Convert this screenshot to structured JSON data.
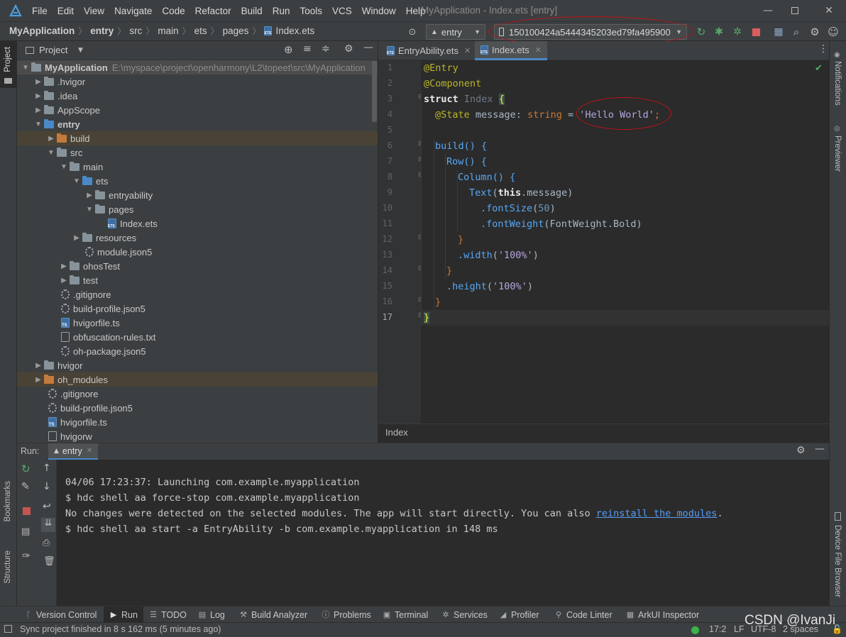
{
  "window": {
    "title": "MyApplication - Index.ets [entry]"
  },
  "menu": [
    "File",
    "Edit",
    "View",
    "Navigate",
    "Code",
    "Refactor",
    "Build",
    "Run",
    "Tools",
    "VCS",
    "Window",
    "Help"
  ],
  "breadcrumb": [
    "MyApplication",
    "entry",
    "src",
    "main",
    "ets",
    "pages",
    "Index.ets"
  ],
  "toolbar": {
    "module_combo": "entry",
    "device_combo": "150100424a5444345203ed79fa495900"
  },
  "project_panel": {
    "title": "Project",
    "root": "MyApplication",
    "root_path": "E:\\myspace\\project\\openharmony\\L2\\topeet\\src\\MyApplication",
    "items": [
      {
        "label": ".hvigor"
      },
      {
        "label": ".idea"
      },
      {
        "label": "AppScope"
      },
      {
        "label": "entry"
      },
      {
        "label": "build"
      },
      {
        "label": "src"
      },
      {
        "label": "main"
      },
      {
        "label": "ets"
      },
      {
        "label": "entryability"
      },
      {
        "label": "pages"
      },
      {
        "label": "Index.ets"
      },
      {
        "label": "resources"
      },
      {
        "label": "module.json5"
      },
      {
        "label": "ohosTest"
      },
      {
        "label": "test"
      },
      {
        "label": ".gitignore"
      },
      {
        "label": "build-profile.json5"
      },
      {
        "label": "hvigorfile.ts"
      },
      {
        "label": "obfuscation-rules.txt"
      },
      {
        "label": "oh-package.json5"
      },
      {
        "label": "hvigor"
      },
      {
        "label": "oh_modules"
      },
      {
        "label": ".gitignore"
      },
      {
        "label": "build-profile.json5"
      },
      {
        "label": "hvigorfile.ts"
      },
      {
        "label": "hvigorw"
      }
    ]
  },
  "editor": {
    "tabs": [
      "EntryAbility.ets",
      "Index.ets"
    ],
    "active_tab": "Index.ets",
    "line_numbers": [
      "1",
      "2",
      "3",
      "4",
      "5",
      "6",
      "7",
      "8",
      "9",
      "10",
      "11",
      "12",
      "13",
      "14",
      "15",
      "16",
      "17"
    ],
    "breadcrumb": "Index",
    "code": {
      "l1": "@Entry",
      "l2": "@Component",
      "l3_kw": "struct",
      "l3_name": "Index",
      "l3_brace": "{",
      "l4_dec": "@State",
      "l4_name": " message: ",
      "l4_type": "string",
      "l4_eq": " = ",
      "l4_str": "'Hello World'",
      "l4_end": ";",
      "l6": "build() {",
      "l7": "Row() {",
      "l8": "Column() {",
      "l9_fn": "Text",
      "l9_open": "(",
      "l9_this": "this",
      "l9_rest": ".message)",
      "l10_m": ".fontSize",
      "l10_open": "(",
      "l10_num": "50",
      "l10_close": ")",
      "l11_m": ".fontWeight",
      "l11_arg": "(FontWeight.Bold)",
      "l12": "}",
      "l13_m": ".width",
      "l13_open": "(",
      "l13_str": "'100%'",
      "l13_close": ")",
      "l14": "}",
      "l15_m": ".height",
      "l15_open": "(",
      "l15_str": "'100%'",
      "l15_close": ")",
      "l16": "}",
      "l17": "}"
    }
  },
  "run_panel": {
    "label": "Run:",
    "tab": "entry",
    "lines": [
      "04/06 17:23:37: Launching com.example.myapplication",
      "$ hdc shell aa force-stop com.example.myapplication",
      "No changes were detected on the selected modules. The app will start directly. You can also ",
      "$ hdc shell aa start -a EntryAbility -b com.example.myapplication in 148 ms"
    ],
    "link": "reinstall the modules",
    "link_suffix": "."
  },
  "tool_tabs": [
    "Version Control",
    "Run",
    "TODO",
    "Log",
    "Build Analyzer",
    "Problems",
    "Terminal",
    "Services",
    "Profiler",
    "Code Linter",
    "ArkUI Inspector"
  ],
  "side_labels": {
    "left_top": "Project",
    "left_bookmarks": "Bookmarks",
    "left_structure": "Structure",
    "right_notifications": "Notifications",
    "right_previewer": "Previewer",
    "right_device": "Device File Browser"
  },
  "status": {
    "message": "Sync project finished in 8 s 162 ms (5 minutes ago)",
    "position": "17:2",
    "line_ending": "LF",
    "encoding": "UTF-8",
    "indent": "2 spaces",
    "watermark": "CSDN @IvanJi"
  },
  "colors": {
    "highlight_oval": "#c0121a",
    "accent": "#4a88c7"
  }
}
